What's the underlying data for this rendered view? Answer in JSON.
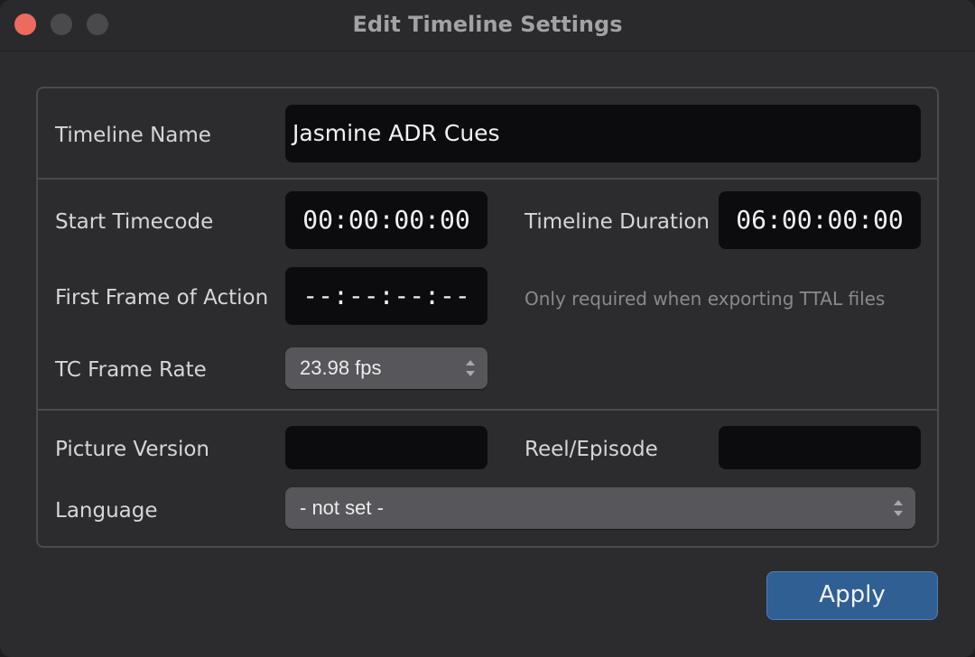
{
  "window": {
    "title": "Edit Timeline Settings"
  },
  "timeline_name": {
    "label": "Timeline Name",
    "value": "Jasmine ADR Cues"
  },
  "start_timecode": {
    "label": "Start Timecode",
    "value": "00:00:00:00"
  },
  "timeline_duration": {
    "label": "Timeline Duration",
    "value": "06:00:00:00"
  },
  "first_frame": {
    "label": "First Frame of Action",
    "value": "--:--:--:--",
    "hint": "Only required when exporting TTAL files"
  },
  "frame_rate": {
    "label": "TC Frame Rate",
    "selected": "23.98 fps"
  },
  "picture_version": {
    "label": "Picture Version",
    "value": ""
  },
  "reel_episode": {
    "label": "Reel/Episode",
    "value": ""
  },
  "language": {
    "label": "Language",
    "selected": "- not set -"
  },
  "actions": {
    "apply_label": "Apply"
  },
  "colors": {
    "window_bg": "#2c2c2f",
    "field_bg": "#0c0c0e",
    "select_bg": "#56565b",
    "apply_bg": "#2f5f93",
    "close_button": "#ed6a5e"
  }
}
